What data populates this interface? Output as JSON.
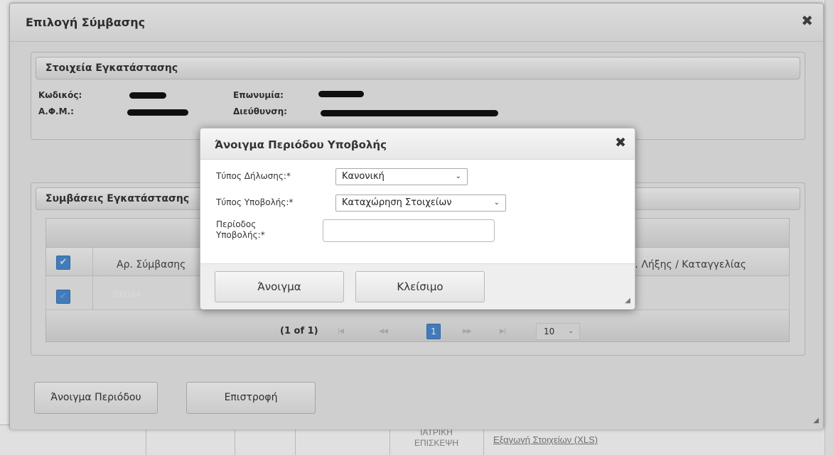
{
  "background": {
    "cell_line1": "ΙΑΤΡΙΚΗ",
    "cell_line2": "ΕΠΙΣΚΕΨΗ",
    "export_link": "Εξαγωγή Στοιχείων (XLS)"
  },
  "outer_dialog": {
    "title": "Επιλογή Σύμβασης",
    "close_glyph": "✖",
    "installation": {
      "legend": "Στοιχεία Εγκατάστασης",
      "code_label": "Κωδικός:",
      "afm_label": "Α.Φ.Μ.:",
      "name_label": "Επωνυμία:",
      "address_label": "Διεύθυνση:"
    },
    "contracts": {
      "legend": "Συμβάσεις Εγκατάστασης",
      "col_contract_no": "Αρ. Σύμβασης",
      "col_end_date": "Ημ. Λήξης / Καταγγελίας",
      "rows": [
        {
          "contract_no": "393164",
          "selected": true
        }
      ],
      "pager": {
        "info": "(1 of 1)",
        "first": "|◀",
        "prev": "◀◀",
        "current_page": "1",
        "next": "▶▶",
        "last": "▶|",
        "page_size": "10"
      }
    },
    "buttons": {
      "open_period": "Άνοιγμα Περιόδου",
      "back": "Επιστροφή"
    }
  },
  "inner_dialog": {
    "title": "Άνοιγμα Περιόδου Υποβολής",
    "close_glyph": "✖",
    "fields": {
      "declaration_type_label": "Τύπος Δήλωσης:*",
      "declaration_type_value": "Κανονική",
      "submission_type_label": "Τύπος Υποβολής:*",
      "submission_type_value": "Καταχώρηση Στοιχείων",
      "period_label_line1": "Περίοδος",
      "period_label_line2": "Υποβολής:*",
      "period_value": ""
    },
    "buttons": {
      "open": "Άνοιγμα",
      "close": "Κλείσιμο"
    }
  },
  "icons": {
    "caret_down": "⌄",
    "check": "✔",
    "resize": "◢"
  },
  "colors": {
    "accent_blue": "#4a8ad0",
    "header_gray": "#e6e6e6",
    "body_gray": "#e7e7e7"
  }
}
